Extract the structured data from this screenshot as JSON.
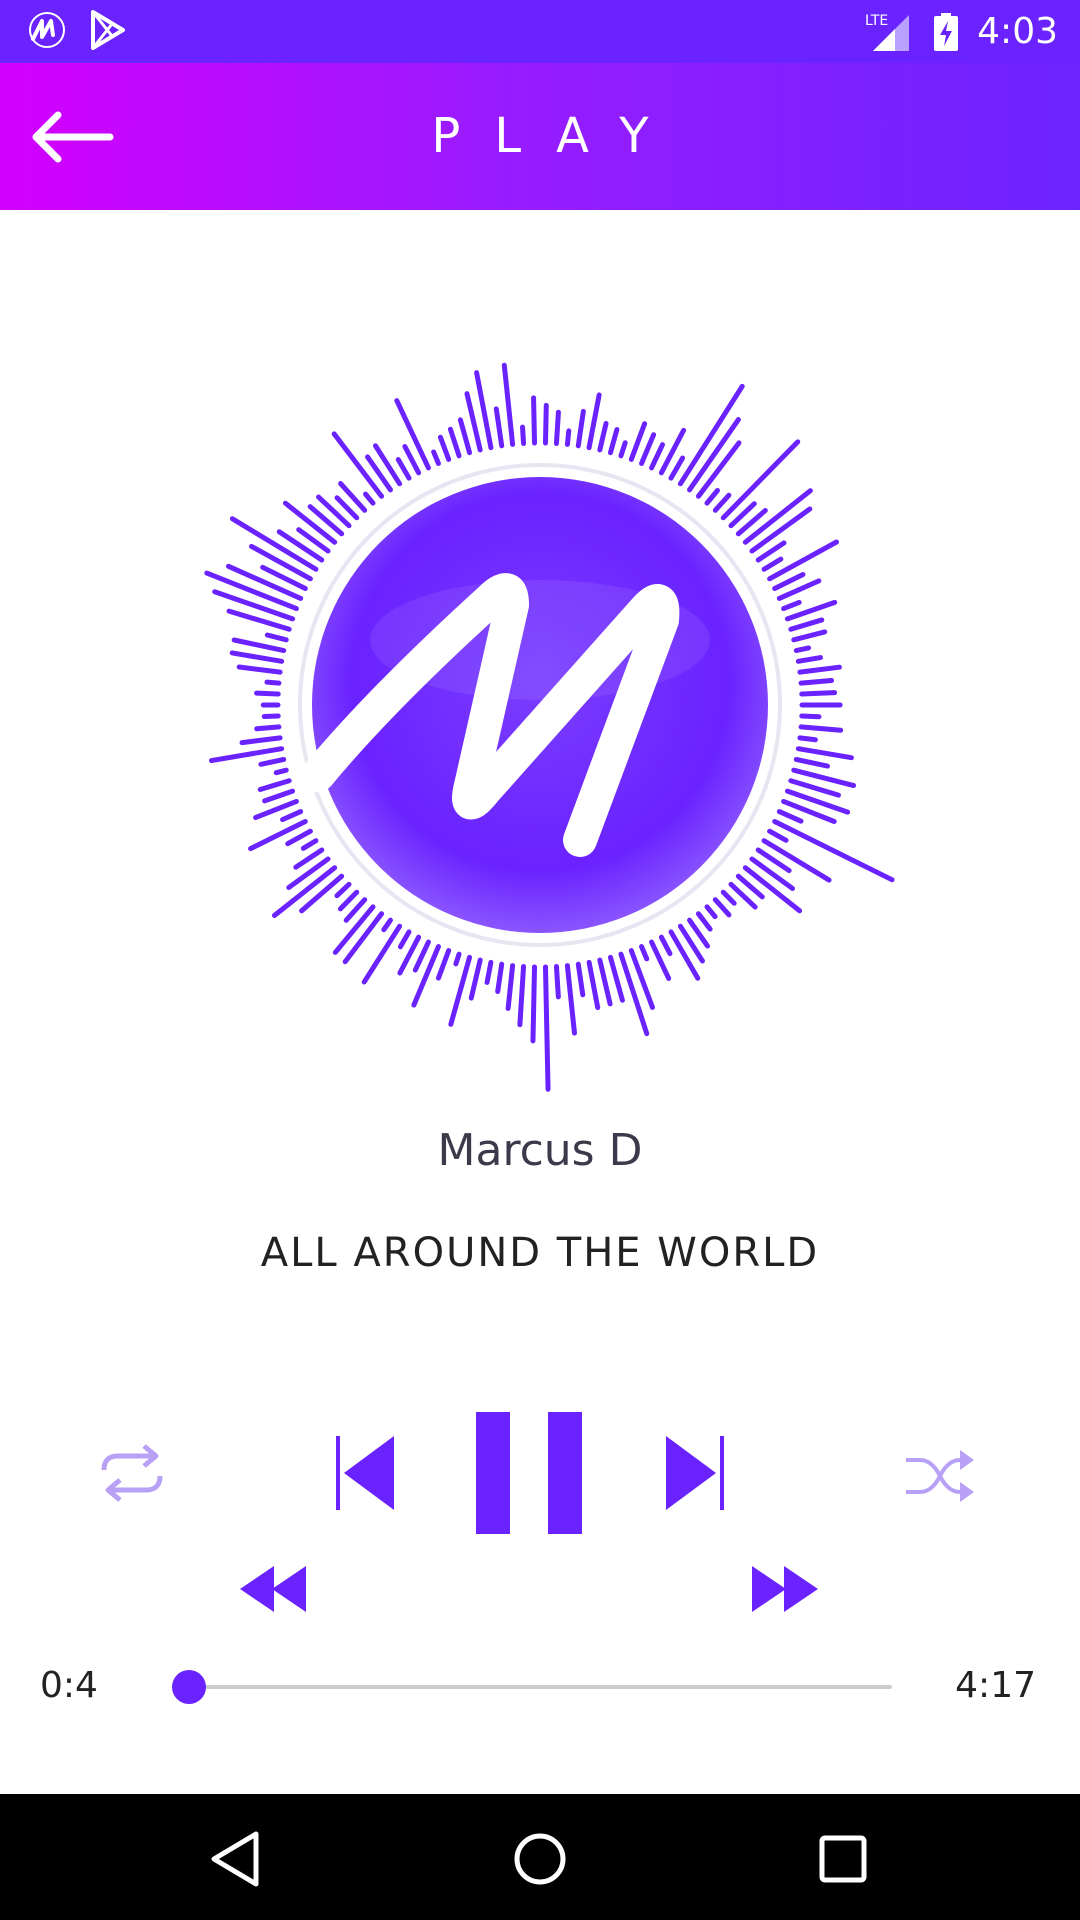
{
  "status_bar": {
    "time": "4:03",
    "network": "LTE",
    "icons": [
      "music-app-notification-icon",
      "play-store-notification-icon",
      "lte-signal-icon",
      "battery-charging-icon"
    ]
  },
  "app_bar": {
    "title": "PLAY",
    "back_icon": "arrow-back-icon"
  },
  "colors": {
    "accent": "#6a22ff",
    "gradient_start": "#d400ff",
    "gradient_end": "#6c24ff",
    "muted_icon": "#b7a0f5"
  },
  "artwork": {
    "logo_letter": "M",
    "visualizer_icon": "audio-visualizer"
  },
  "track": {
    "artist": "Marcus D",
    "title": "ALL AROUND THE WORLD"
  },
  "controls": {
    "repeat": "repeat-icon",
    "previous": "skip-previous-icon",
    "pause": "pause-icon",
    "next": "skip-next-icon",
    "shuffle": "shuffle-icon",
    "rewind": "rewind-icon",
    "fast_forward": "fast-forward-icon"
  },
  "progress": {
    "elapsed": "0:4",
    "duration": "4:17",
    "fraction": 0.016
  },
  "nav_bar": {
    "icons": [
      "nav-back-icon",
      "nav-home-icon",
      "nav-recents-icon"
    ]
  }
}
